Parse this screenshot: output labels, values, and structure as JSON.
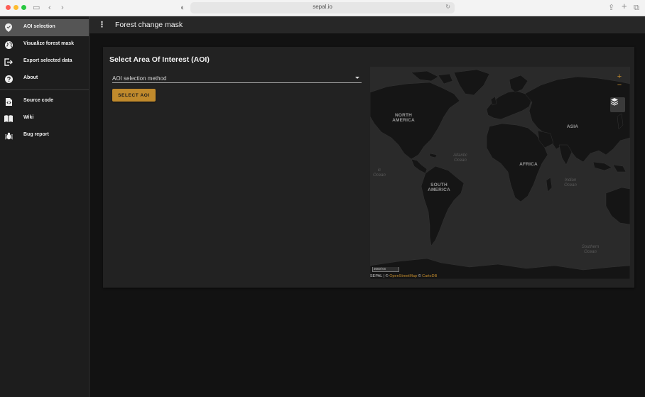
{
  "browser": {
    "url": "sepal.io"
  },
  "sidebar": {
    "items": [
      {
        "label": "AOI selection",
        "icon": "map-pin-icon",
        "active": true
      },
      {
        "label": "Visualize forest mask",
        "icon": "globe-icon",
        "active": false
      },
      {
        "label": "Export selected data",
        "icon": "export-icon",
        "active": false
      },
      {
        "label": "About",
        "icon": "question-icon",
        "active": false
      }
    ],
    "links": [
      {
        "label": "Source code",
        "icon": "code-file-icon"
      },
      {
        "label": "Wiki",
        "icon": "book-icon"
      },
      {
        "label": "Bug report",
        "icon": "bug-icon"
      }
    ]
  },
  "appbar": {
    "title": "Forest change mask"
  },
  "card": {
    "title": "Select Area Of Interest (AOI)",
    "select": {
      "value": "AOI selection method"
    },
    "button_label": "SELECT AOI"
  },
  "map": {
    "zoom_in": "+",
    "zoom_out": "−",
    "labels": {
      "north_america": "NORTH\nAMERICA",
      "south_america": "SOUTH\nAMERICA",
      "africa": "AFRICA",
      "asia": "ASIA",
      "atlantic": "Atlantic\nOcean",
      "pacific": "ic\nOcean",
      "indian": "Indian\nOcean",
      "southern": "Southern\nOcean"
    },
    "scale": "3000 km",
    "attribution": {
      "prefix": "SEPAL | ©",
      "osm": "OpenStreetMap",
      "mid": "©",
      "carto": "CartoDB"
    }
  },
  "colors": {
    "accent": "#c08a2c",
    "background": "#121212",
    "sidebar": "#1d1d1d",
    "card": "#222222",
    "land": "#141414",
    "water": "#2a2a2a"
  }
}
